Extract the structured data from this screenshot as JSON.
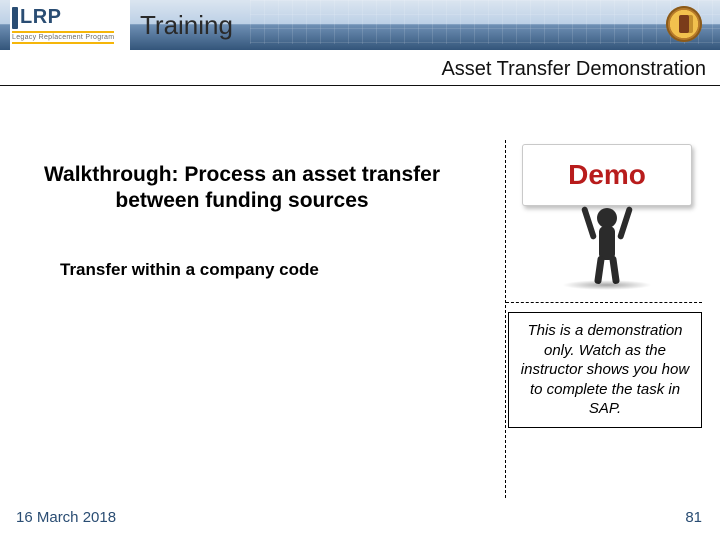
{
  "header": {
    "logo_main": "LRP",
    "logo_sub": "Legacy Replacement Program",
    "title": "Training",
    "seal_name": "organization-seal"
  },
  "subtitle": "Asset Transfer Demonstration",
  "walkthrough": {
    "line1": "Walkthrough:  Process an asset transfer",
    "line2": "between funding sources"
  },
  "transfer_line": "Transfer within a company code",
  "demo": {
    "label": "Demo"
  },
  "note": "This is a demonstration only. Watch as the instructor shows you how to complete the task in SAP.",
  "footer": {
    "date": "16 March 2018",
    "page": "81"
  }
}
